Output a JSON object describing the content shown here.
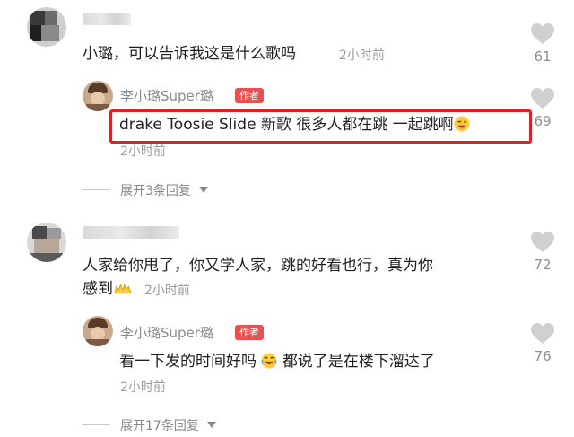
{
  "comments": [
    {
      "text": "小璐，可以告诉我这是什么歌吗",
      "time": "2小时前",
      "likes": "61",
      "reply": {
        "username": "李小璐Super璐",
        "badge": "作者",
        "text": "drake Toosie Slide 新歌 很多人都在跳 一起跳啊",
        "time": "2小时前",
        "likes": "69"
      },
      "expand_label": "展开3条回复"
    },
    {
      "text_line1": "人家给你甩了，你又学人家，跳的好看也行，真为你",
      "text_line2": "感到",
      "time": "2小时前",
      "likes": "72",
      "reply": {
        "username": "李小璐Super璐",
        "badge": "作者",
        "text_part1": "看一下发的时间好吗",
        "text_part2": "都说了是在楼下溜达了",
        "time": "2小时前",
        "likes": "76"
      },
      "expand_label": "展开17条回复"
    }
  ],
  "colors": {
    "badge": "#e8514f",
    "highlight": "#e02020",
    "heart": "#d0d0d0"
  },
  "icons": [
    "heart-icon",
    "chevron-down-icon",
    "wink-emoji",
    "laugh-cry-emoji",
    "clap-emoji"
  ]
}
